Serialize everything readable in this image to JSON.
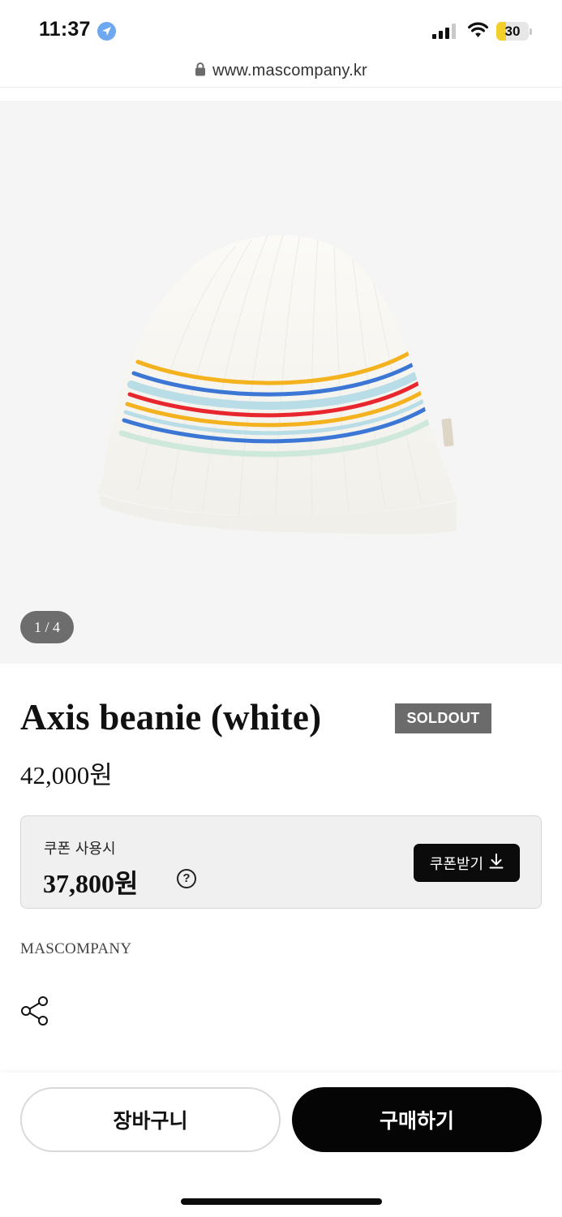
{
  "status_bar": {
    "time": "11:37",
    "battery_level": "30",
    "battery_fraction": 0.3,
    "icons": [
      "location-arrow-icon",
      "signal-icon",
      "wifi-icon",
      "battery-icon"
    ]
  },
  "browser": {
    "url": "www.mascompany.kr",
    "icons": [
      "lock-icon"
    ]
  },
  "gallery": {
    "page_indicator": "1 / 4"
  },
  "product": {
    "title": "Axis beanie (white)",
    "badge": "SOLDOUT",
    "price": "42,000원",
    "brand": "MASCOMPANY"
  },
  "coupon": {
    "label": "쿠폰 사용시",
    "price": "37,800원",
    "help_symbol": "?",
    "button_label": "쿠폰받기"
  },
  "actions": {
    "cart_label": "장바구니",
    "buy_label": "구매하기"
  },
  "colors": {
    "badge_bg": "#6b6b6b",
    "buy_button_bg": "#050505",
    "battery_fill": "#f2cf2b",
    "stripe_yellow": "#f4b31e",
    "stripe_blue": "#3c77d6",
    "stripe_red": "#e8262e",
    "stripe_light_blue": "#b9dde6"
  }
}
